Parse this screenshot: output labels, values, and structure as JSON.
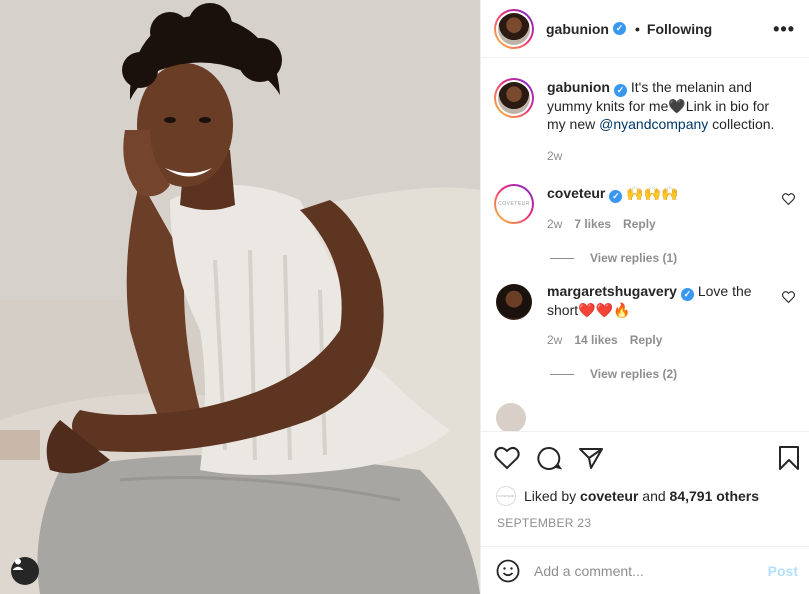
{
  "photo": {
    "tag_icon": "user-tag-icon"
  },
  "header": {
    "username": "gabunion",
    "separator": "•",
    "follow_status": "Following",
    "more_label": "•••"
  },
  "caption": {
    "username": "gabunion",
    "text_before": "It's the melanin and yummy knits for me🖤Link in bio for my new ",
    "mention": "@nyandcompany",
    "text_after": " collection.",
    "age": "2w"
  },
  "comments": [
    {
      "username": "coveteur",
      "text": "🙌🙌🙌",
      "age": "2w",
      "likes": "7 likes",
      "reply": "Reply",
      "view_replies": "View replies (1)",
      "avatar_text": "COVETEUR"
    },
    {
      "username": "margaretshugavery",
      "text": "Love the short❤️❤️🔥",
      "age": "2w",
      "likes": "14 likes",
      "reply": "Reply",
      "view_replies": "View replies (2)"
    }
  ],
  "likes": {
    "prefix": "Liked by ",
    "user": "coveteur",
    "middle": " and ",
    "count": "84,791 others",
    "avatar_text": "COVETEUR"
  },
  "date": "SEPTEMBER 23",
  "add_comment": {
    "placeholder": "Add a comment...",
    "post_label": "Post"
  },
  "colors": {
    "verified": "#3897f0",
    "link": "#00376b",
    "muted": "#8e8e8e",
    "post_disabled": "#b2dffc"
  }
}
